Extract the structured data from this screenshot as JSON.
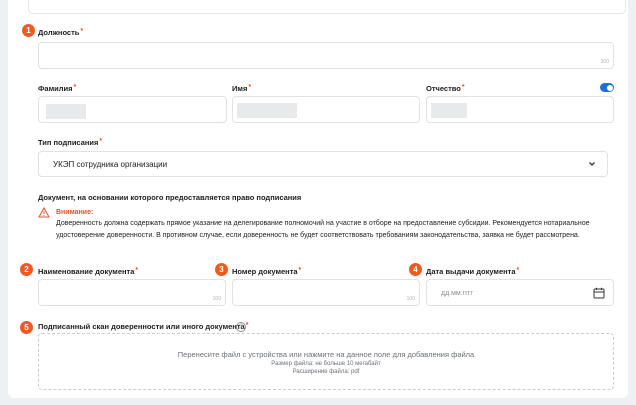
{
  "position": {
    "badge": "1",
    "label": "Должность",
    "counter": "300"
  },
  "name": {
    "last_name_label": "Фамилия",
    "first_name_label": "Имя",
    "patronymic_label": "Отчество"
  },
  "signature": {
    "label": "Тип подписания",
    "value": "УКЭП сотрудника организации"
  },
  "document_section": {
    "title": "Документ, на основании которого предоставляется право подписания",
    "warning_title": "Внимание:",
    "warning_text": "Доверенность должна содержать прямое указание на делегирование полномочий на участие в отборе на предоставление субсидии. Рекомендуется нотариальное удостоверение доверенности. В противном случае, если доверенность не будет соответствовать требованиям законодательства, заявка не будет рассмотрена."
  },
  "doc_fields": {
    "name_badge": "2",
    "name_label": "Наименование документа",
    "name_counter": "100",
    "number_badge": "3",
    "number_label": "Номер документа",
    "number_counter": "100",
    "date_badge": "4",
    "date_label": "Дата выдачи документа",
    "date_placeholder": "дд.мм.гггг"
  },
  "upload": {
    "badge": "5",
    "label": "Подписанный скан доверенности или иного документа",
    "help": "?",
    "main_text": "Перенесите файл с устройства или нажмите на данное поле для добавления файла",
    "size_text": "Размер файла: не больше 10 мегабайт",
    "ext_text": "Расширение файла: pdf"
  },
  "colors": {
    "accent": "#f05a22",
    "toggle": "#1f6fd9",
    "required": "#e5512b"
  }
}
